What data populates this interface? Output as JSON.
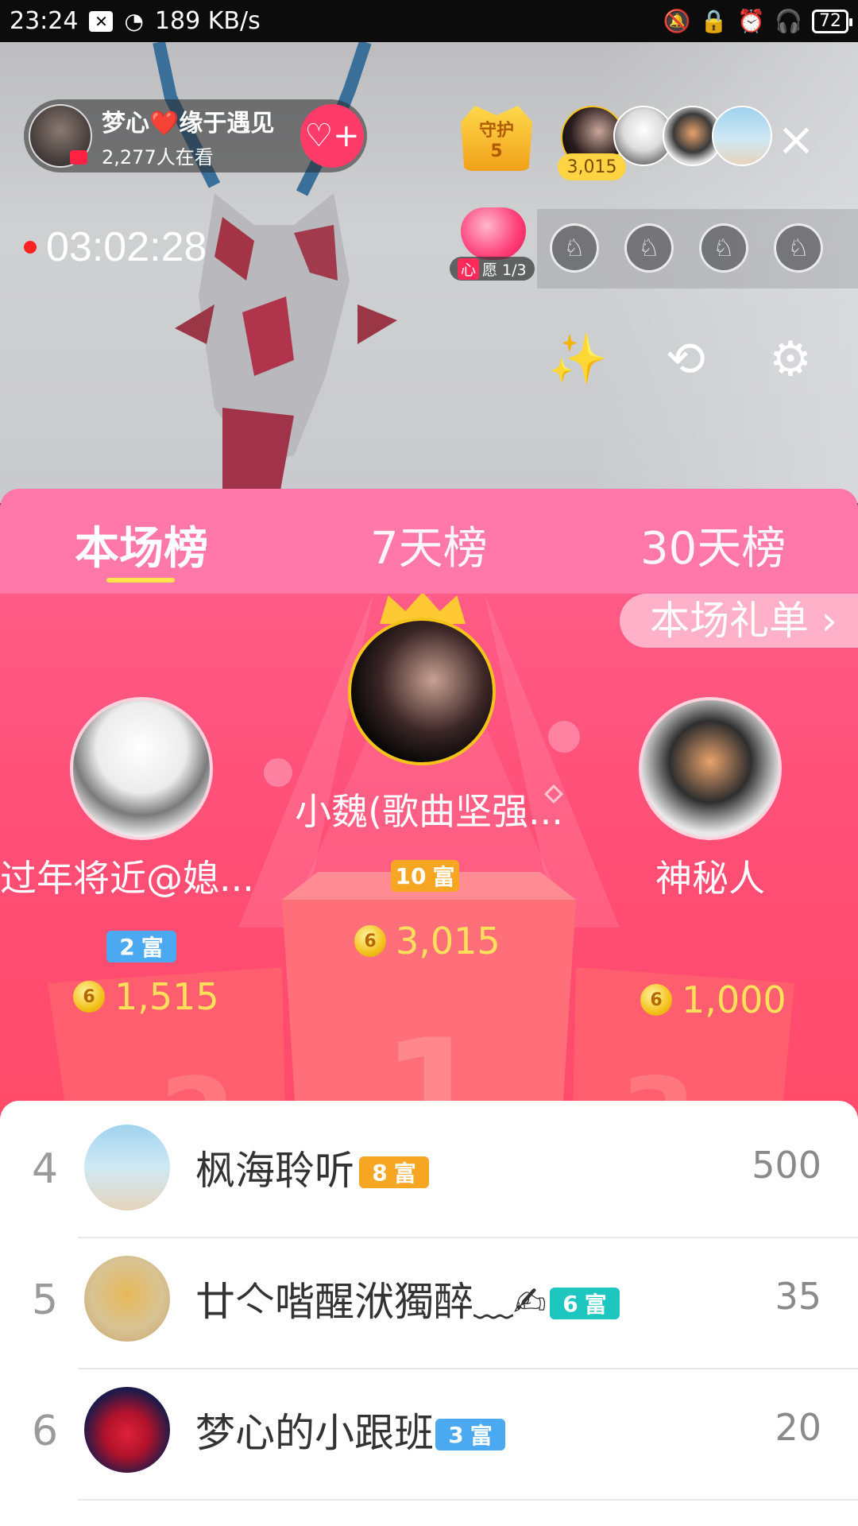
{
  "status_bar": {
    "time": "23:24",
    "speed": "189 KB/s",
    "battery": "72"
  },
  "host": {
    "name": "梦心❤️缘于遇见",
    "viewers": "2,277人在看"
  },
  "guard": {
    "label": "守护",
    "count": "5"
  },
  "top_viewer_badge": "3,015",
  "timer": "03:02:28",
  "wish": {
    "label_a": "心",
    "label_b": "愿 1/3"
  },
  "tabs": [
    "本场榜",
    "7天榜",
    "30天榜"
  ],
  "gift_list_label": "本场礼单 ›",
  "podium": {
    "first": {
      "name": "小魏(歌曲坚强...",
      "level": "10",
      "level_label": "富",
      "coins": "3,015",
      "rank_glyph": "1"
    },
    "second": {
      "name": "过年将近@媳...",
      "level": "2",
      "level_label": "富",
      "coins": "1,515",
      "rank_glyph": "2"
    },
    "third": {
      "name": "神秘人",
      "coins": "1,000",
      "rank_glyph": "3"
    }
  },
  "coin_symbol": "6",
  "ranking": [
    {
      "rank": "4",
      "name": "枫海聆听",
      "level": "8",
      "level_label": "富",
      "score": "500",
      "badge_color": "#f6a623"
    },
    {
      "rank": "5",
      "name": "廿亽喈醒洑獨醉﹏✍",
      "level": "6",
      "level_label": "富",
      "score": "35",
      "badge_color": "#1ec6c0"
    },
    {
      "rank": "6",
      "name": "梦心的小跟班",
      "level": "3",
      "level_label": "富",
      "score": "20",
      "badge_color": "#4aa9f0"
    }
  ],
  "icons": {
    "close": "×",
    "follow": "♡+",
    "seat": "♘",
    "magic": "✨",
    "camera_switch": "⟲",
    "settings": "⚙"
  }
}
